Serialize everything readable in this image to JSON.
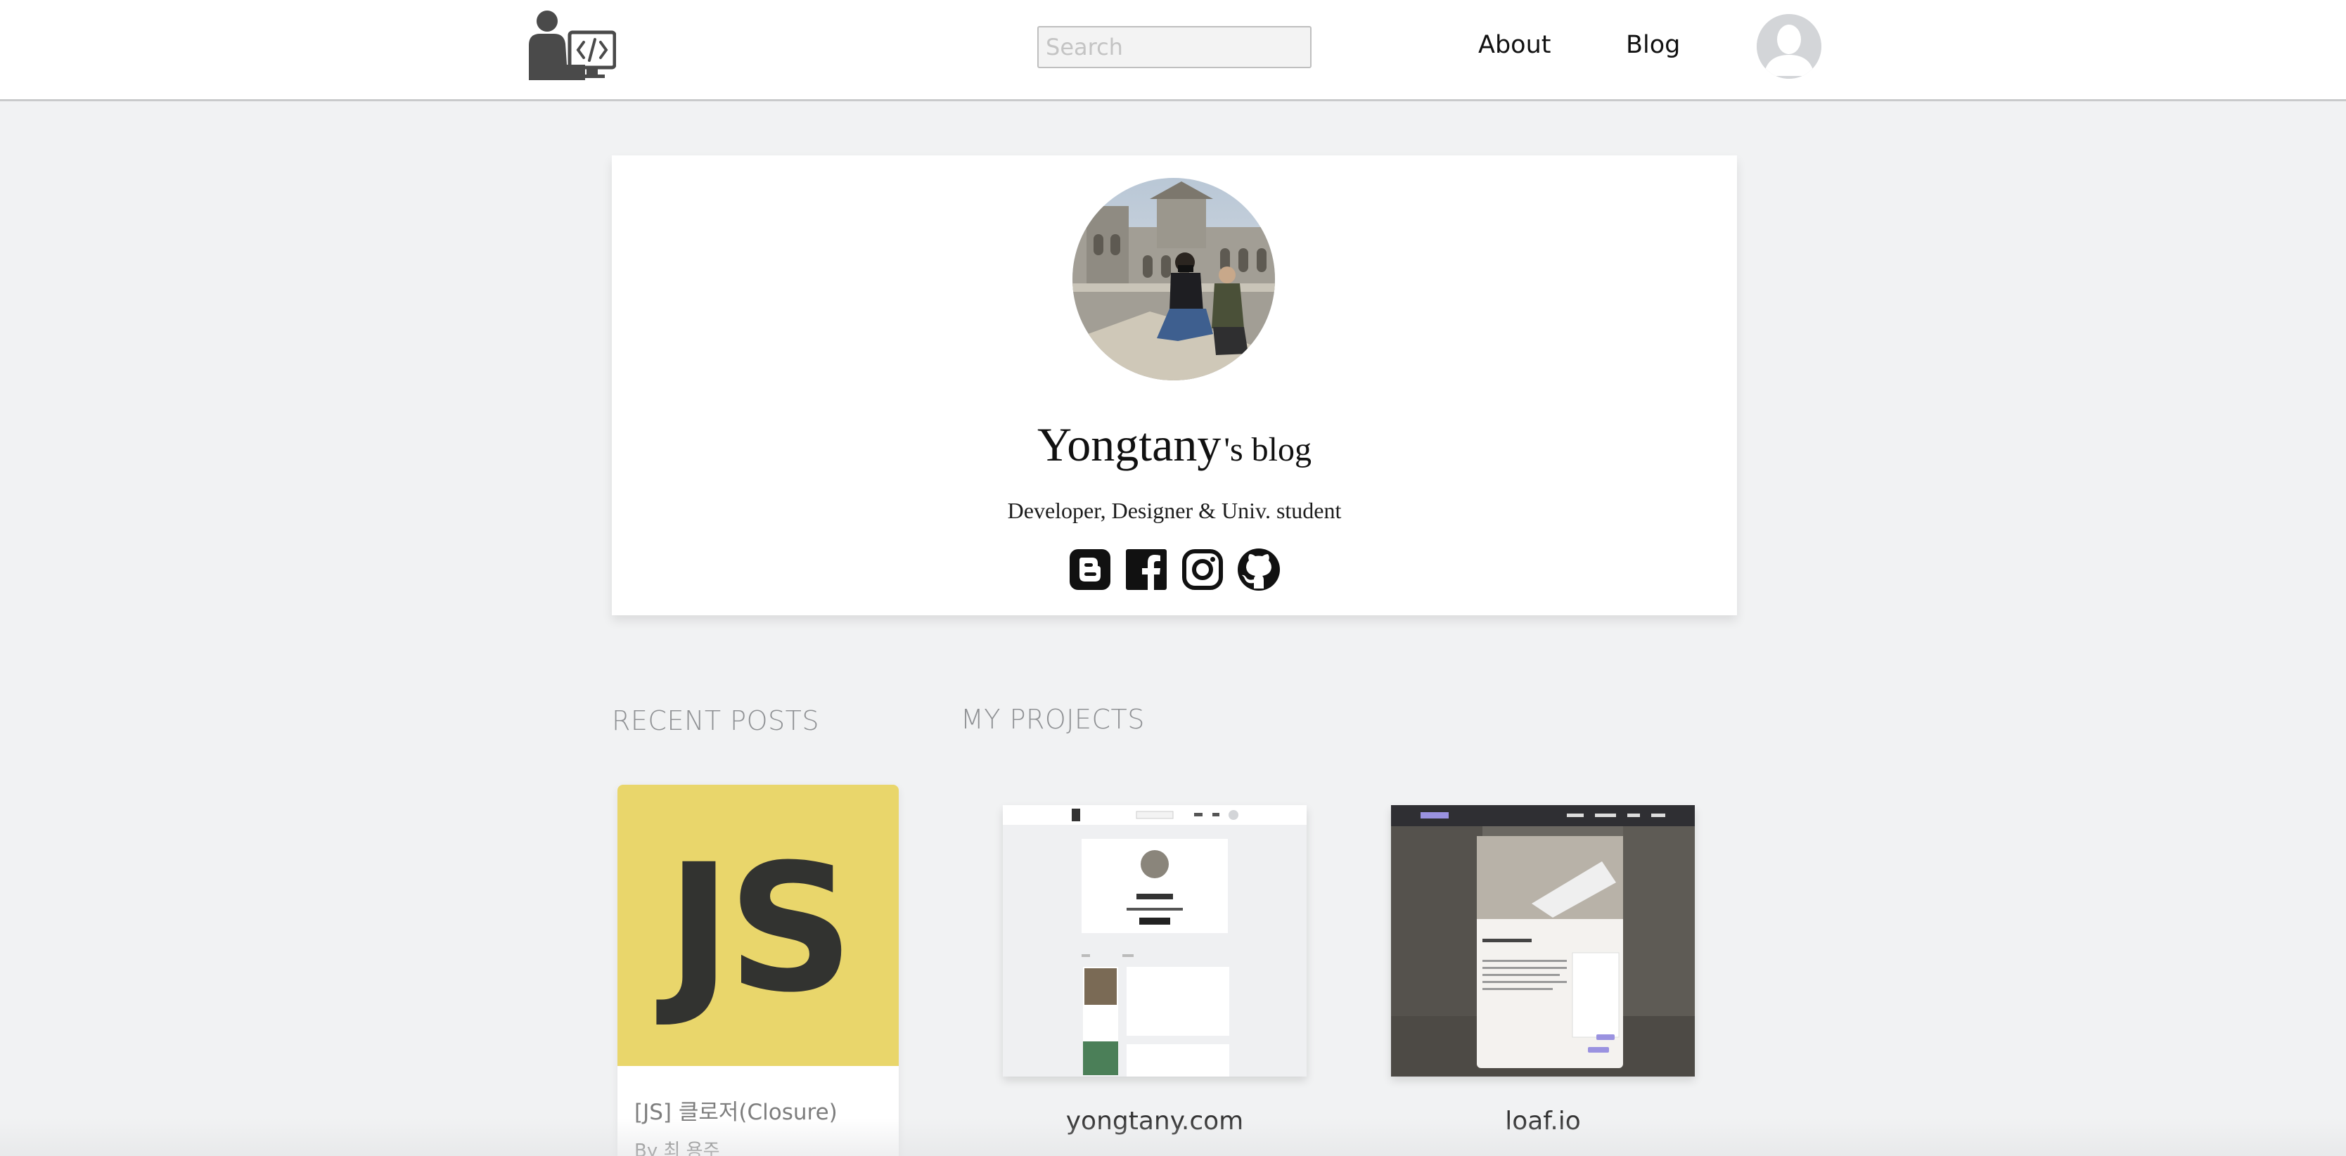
{
  "header": {
    "logo_icon": "developer-at-computer-icon",
    "search": {
      "placeholder": "Search",
      "value": ""
    },
    "nav": {
      "about_label": "About",
      "blog_label": "Blog"
    },
    "avatar_icon": "user-avatar-icon"
  },
  "profile": {
    "name": "Yongtany",
    "title_suffix": "'s blog",
    "subtitle": "Developer, Designer & Univ. student",
    "social_icons": [
      "blogger-icon",
      "facebook-icon",
      "instagram-icon",
      "github-icon"
    ]
  },
  "sections": {
    "recent_posts_heading": "RECENT POSTS",
    "my_projects_heading": "MY PROJECTS"
  },
  "recent_posts": [
    {
      "thumbnail_text": "JS",
      "title": "[JS] 클로저(Closure)",
      "author": "By 최 용주"
    }
  ],
  "projects": [
    {
      "label": "yongtany.com"
    },
    {
      "label": "loaf.io"
    }
  ],
  "colors": {
    "page_background": "#f1f2f3",
    "header_background": "#ffffff",
    "js_yellow": "#e9d66b",
    "js_text": "#323330",
    "heading_gray": "#8f9194"
  }
}
